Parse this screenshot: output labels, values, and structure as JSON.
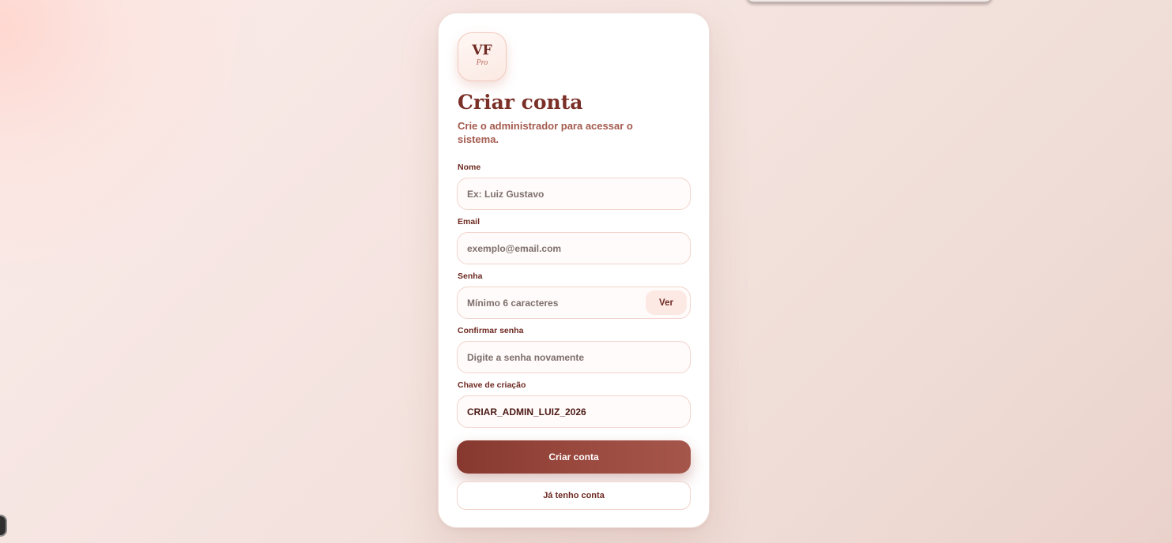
{
  "brand": {
    "logo_main": "VF",
    "logo_sub": "Pro"
  },
  "form": {
    "title": "Criar conta",
    "subtitle": "Crie o administrador para acessar o sistema.",
    "fields": {
      "name": {
        "label": "Nome",
        "placeholder": "Ex: Luiz Gustavo",
        "value": ""
      },
      "email": {
        "label": "Email",
        "placeholder": "exemplo@email.com",
        "value": ""
      },
      "password": {
        "label": "Senha",
        "placeholder": "Mínimo 6 caracteres",
        "value": "",
        "toggle_label": "Ver"
      },
      "confirm_password": {
        "label": "Confirmar senha",
        "placeholder": "Digite a senha novamente",
        "value": ""
      },
      "creation_key": {
        "label": "Chave de criação",
        "placeholder": "",
        "value": "CRIAR_ADMIN_LUIZ_2026"
      }
    },
    "submit_label": "Criar conta",
    "login_label": "Já tenho conta"
  },
  "colors": {
    "brand_dark": "#7a2f27",
    "accent_text": "#a45a4e",
    "button_gradient_start": "#86382f",
    "button_gradient_end": "#a5564a",
    "background": "#f4e3df"
  }
}
